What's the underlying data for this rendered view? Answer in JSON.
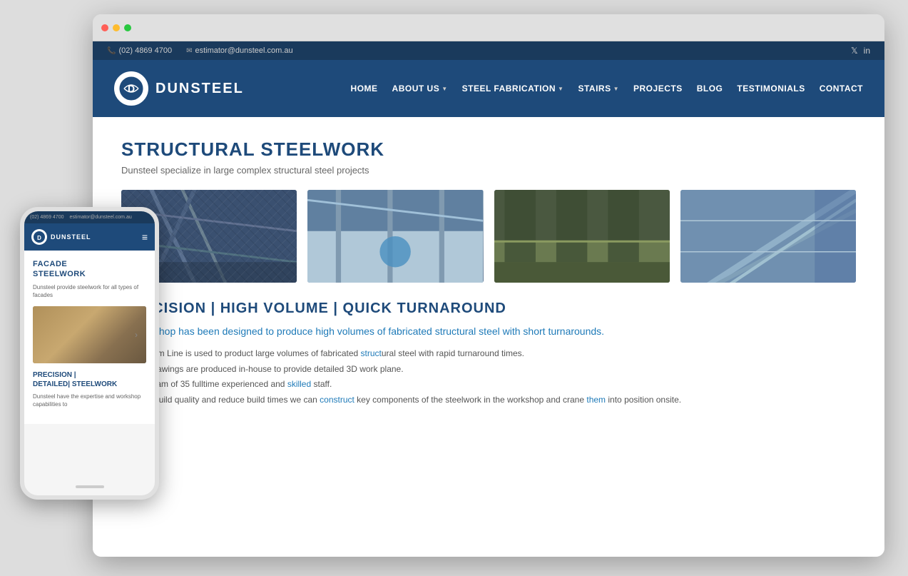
{
  "scene": {
    "background_color": "#ddd"
  },
  "browser": {
    "dots": [
      "red",
      "yellow",
      "green"
    ]
  },
  "topbar": {
    "phone": "(02) 4869 4700",
    "email": "estimator@dunsteel.com.au",
    "phone_icon": "📞",
    "email_icon": "✉",
    "social": [
      "twitter",
      "linkedin"
    ]
  },
  "nav": {
    "logo_text": "DUNSTEEL",
    "logo_initials": "D",
    "menu_items": [
      {
        "label": "HOME",
        "has_arrow": false
      },
      {
        "label": "ABOUT US",
        "has_arrow": true
      },
      {
        "label": "STEEL FABRICATION",
        "has_arrow": true
      },
      {
        "label": "STAIRS",
        "has_arrow": true
      },
      {
        "label": "PROJECTS",
        "has_arrow": false
      },
      {
        "label": "BLOG",
        "has_arrow": false
      },
      {
        "label": "TESTIMONIALS",
        "has_arrow": false
      },
      {
        "label": "CONTACT",
        "has_arrow": false
      }
    ]
  },
  "main": {
    "page_title": "STRUCTURAL STEELWORK",
    "page_subtitle": "Dunsteel specialize in large complex structural steel projects",
    "section_headline": "PRECISION | HIGH VOLUME | QUICK TURNAROUND",
    "section_intro": "ur workshop has been designed to produce high volumes of fabricated structural steel with short\nrnarounds.",
    "bullet_1": "CNC Beam Line is used to product large volumes of fabricated structural steel with rapid turnaround times.",
    "bullet_2": "rkshop drawings are produced in-house to provide detailed 3D work plane.",
    "bullet_3": "have a team of 35 fulltime experienced and skilled staff.",
    "bullet_4": "improve build quality and reduce build times we can construct key components of the steelwork in the workshop and crane them into position onsite."
  },
  "mobile": {
    "phone": "(02) 4869 4700",
    "email": "estimator@dunsteel.com.au",
    "logo_text": "DUNSTEEL",
    "section1_title": "FACADE\nSTEELWORK",
    "section1_desc": "Dunsteel provide steelwork for all types of facades",
    "section2_title": "PRECISION |\nDETAILED| STEELWORK",
    "section2_desc": "Dunsteel have the expertise and workshop capabilities to"
  }
}
